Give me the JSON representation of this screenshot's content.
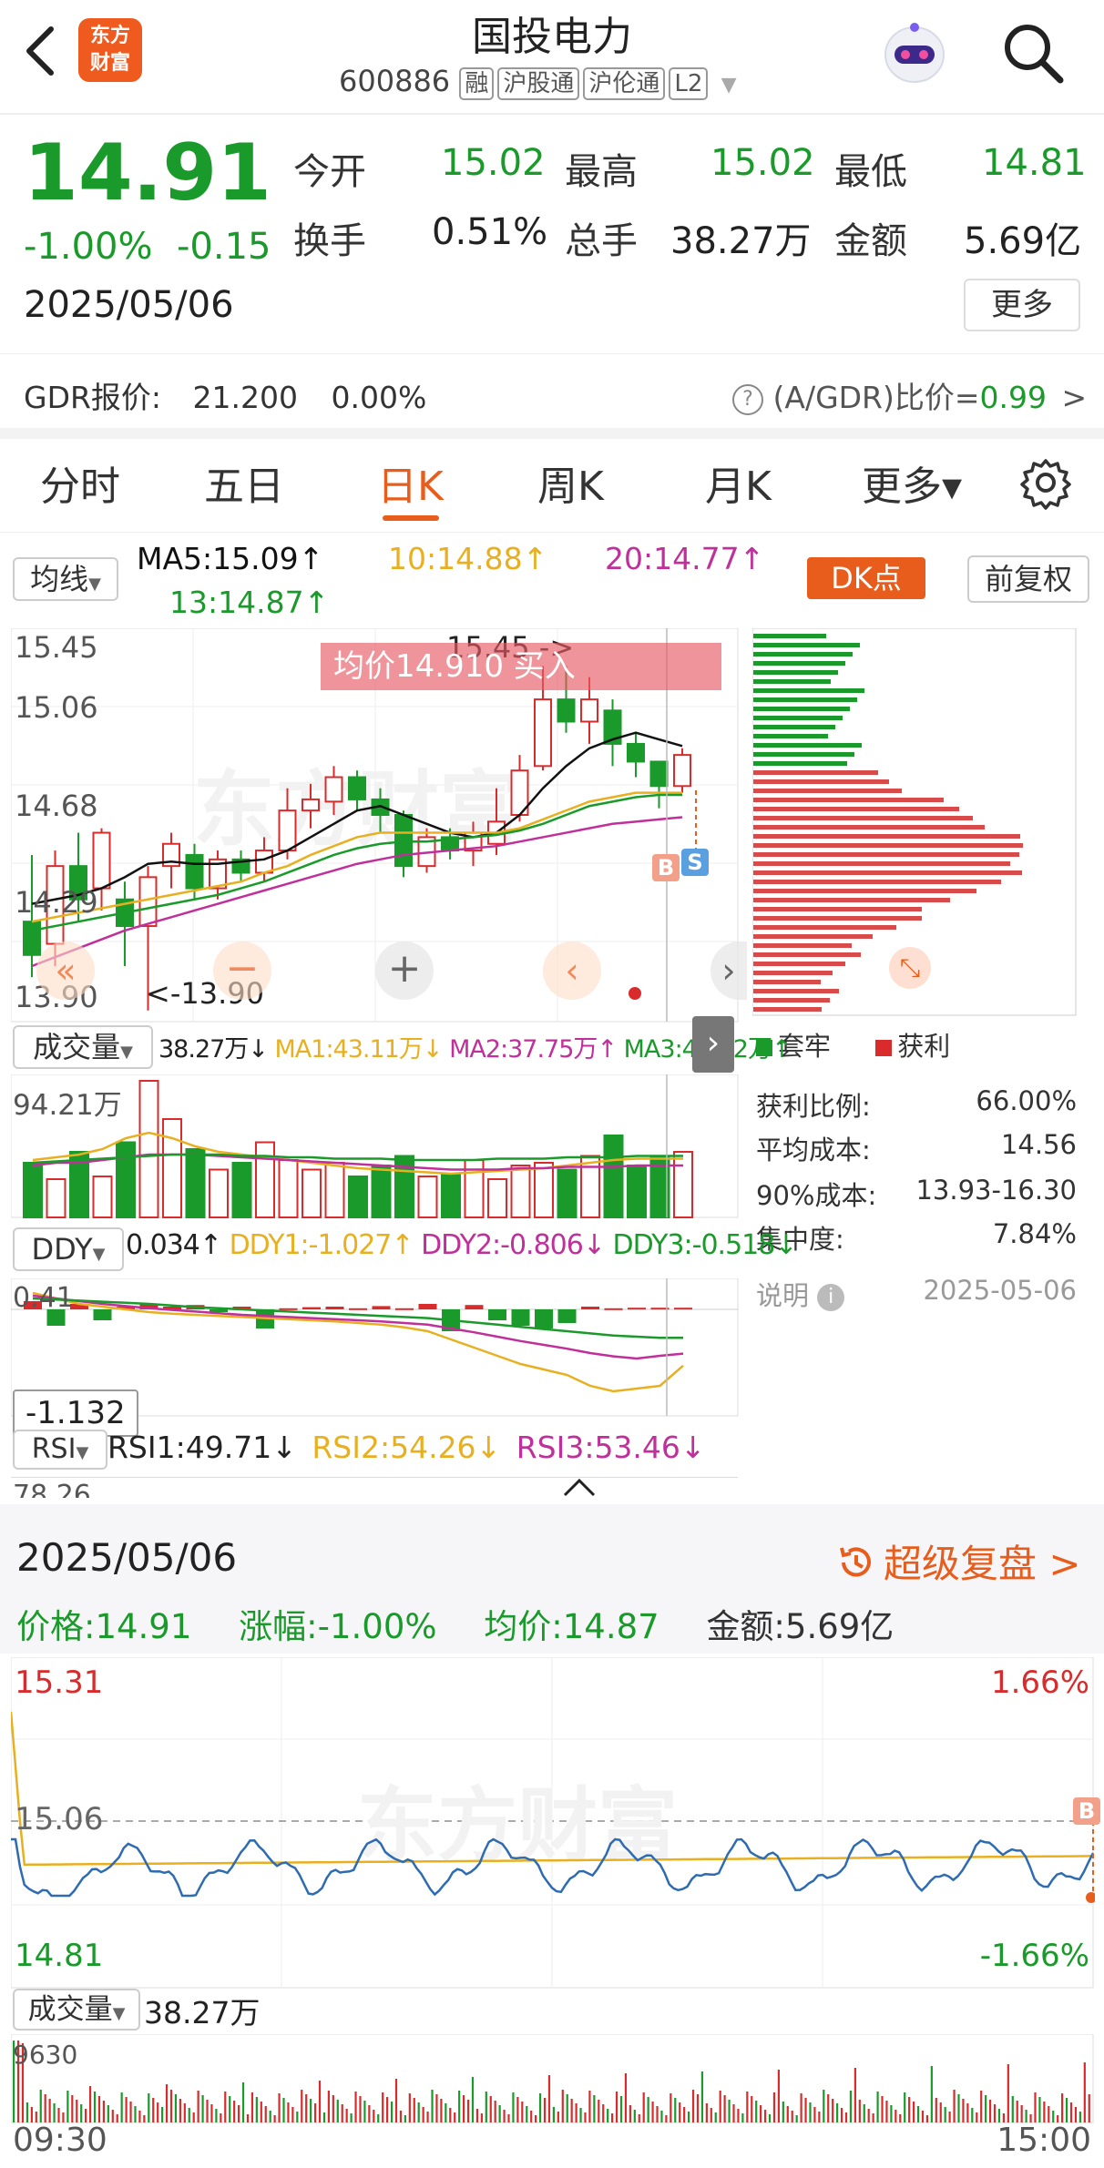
{
  "header": {
    "title": "国投电力",
    "code": "600886",
    "tags": [
      "融",
      "沪股通",
      "沪伦通",
      "L2"
    ],
    "logo_text": "东方财富"
  },
  "quote": {
    "price": "14.91",
    "change_pct": "-1.00%",
    "change": "-0.15",
    "date": "2025/05/06",
    "stats": [
      {
        "label": "今开",
        "value": "15.02",
        "color": "green"
      },
      {
        "label": "最高",
        "value": "15.02",
        "color": "green"
      },
      {
        "label": "最低",
        "value": "14.81",
        "color": "green"
      },
      {
        "label": "换手",
        "value": "0.51%",
        "color": "dark"
      },
      {
        "label": "总手",
        "value": "38.27万",
        "color": "dark"
      },
      {
        "label": "金额",
        "value": "5.69亿",
        "color": "dark"
      }
    ],
    "more_label": "更多",
    "gdr_label": "GDR报价:",
    "gdr_price": "21.200",
    "gdr_change": "0.00%",
    "gdr_ratio_label": "(A/GDR)比价=",
    "gdr_ratio": "0.99",
    "gdr_arrow": ">"
  },
  "tabs": [
    {
      "label": "分时",
      "active": false
    },
    {
      "label": "五日",
      "active": false
    },
    {
      "label": "日K",
      "active": true
    },
    {
      "label": "周K",
      "active": false
    },
    {
      "label": "月K",
      "active": false
    },
    {
      "label": "更多▾",
      "active": false
    }
  ],
  "ma_bar": {
    "selector": "均线",
    "ma5": "MA5:15.09↑",
    "ma10": "10:14.88↑",
    "ma20": "20:14.77↑",
    "ma13": "13:14.87↑",
    "dk_label": "DK点",
    "fq_label": "前复权"
  },
  "kline": {
    "y_labels": [
      "15.45",
      "15.06",
      "14.68",
      "14.29",
      "13.90"
    ],
    "high_label": "15.45 ->",
    "low_label": "<-13.90",
    "avg_banner": "均价14.910  买入",
    "b_marker": "B",
    "s_marker": "S"
  },
  "chip_panel": {
    "legend_locked": "套牢",
    "legend_profit": "获利",
    "rows": [
      {
        "label": "获利比例:",
        "value": "66.00%"
      },
      {
        "label": "平均成本:",
        "value": "14.56"
      },
      {
        "label": "90%成本:",
        "value": "13.93-16.30"
      },
      {
        "label": "集中度:",
        "value": "7.84%"
      }
    ],
    "note_label": "说明",
    "note_date": "2025-05-06"
  },
  "volume": {
    "selector": "成交量",
    "vol": "38.27万↓",
    "ma1": "MA1:43.11万↓",
    "ma2": "MA2:37.75万↑",
    "ma3": "MA3:44.82万↑",
    "max_label": "94.21万"
  },
  "ddy": {
    "selector": "DDY",
    "value": "0.034↑",
    "ddy1": "DDY1:-1.027↑",
    "ddy2": "DDY2:-0.806↓",
    "ddy3": "DDY3:-0.518↓",
    "top_label": "0.41",
    "bottom_label": "-1.132"
  },
  "rsi": {
    "selector": "RSI",
    "rsi1": "RSI1:49.71↓",
    "rsi2": "RSI2:54.26↓",
    "rsi3": "RSI3:53.46↓",
    "top_label": "78.26"
  },
  "intraday": {
    "date": "2025/05/06",
    "replay_label": "超级复盘 >",
    "price": "价格:14.91",
    "change": "涨幅:-1.00%",
    "avg": "均价:14.87",
    "amount": "金额:5.69亿",
    "top_price": "15.31",
    "top_pct": "1.66%",
    "mid_price": "15.06",
    "bottom_price": "14.81",
    "bottom_pct": "-1.66%",
    "b_marker": "B",
    "vol_selector": "成交量",
    "vol_value": "38.27万",
    "vol_max": "9630",
    "time_start": "09:30",
    "time_end": "15:00",
    "watermark": "东方财富"
  },
  "colors": {
    "up": "#d92b2b",
    "down": "#1a9a2a",
    "accent": "#e85d1c",
    "ma5": "#111111",
    "ma10": "#e8b020",
    "ma20": "#c0309a",
    "ma13": "#1a9a2a"
  }
}
